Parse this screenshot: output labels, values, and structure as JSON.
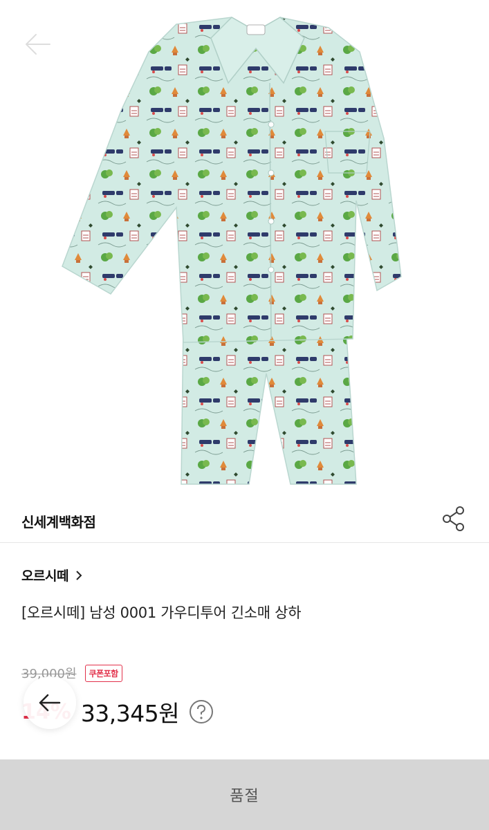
{
  "hero": {
    "image": "mens-pajama-set-mint-travel-print",
    "nav_back_icon": "arrow-left-icon"
  },
  "seller": {
    "name": "신세계백화점",
    "share_icon": "share-icon"
  },
  "product": {
    "brand": "오르시떼",
    "brand_link_icon": "chevron-right-icon",
    "title": "[오르시떼] 남성 0001 가우디투어 긴소매 상하"
  },
  "price": {
    "original": "39,000원",
    "coupon_badge": "쿠폰포함",
    "discount_rate": "14%",
    "sale": "33,345원",
    "help_icon": "question-circle-icon"
  },
  "floating_nav": {
    "icon": "arrow-left-icon"
  },
  "buy_bar": {
    "label": "품절"
  },
  "colors": {
    "accent_red": "#e2304a",
    "soldout_bg": "#d6d6d6",
    "garment_mint": "#cfe8e2"
  }
}
